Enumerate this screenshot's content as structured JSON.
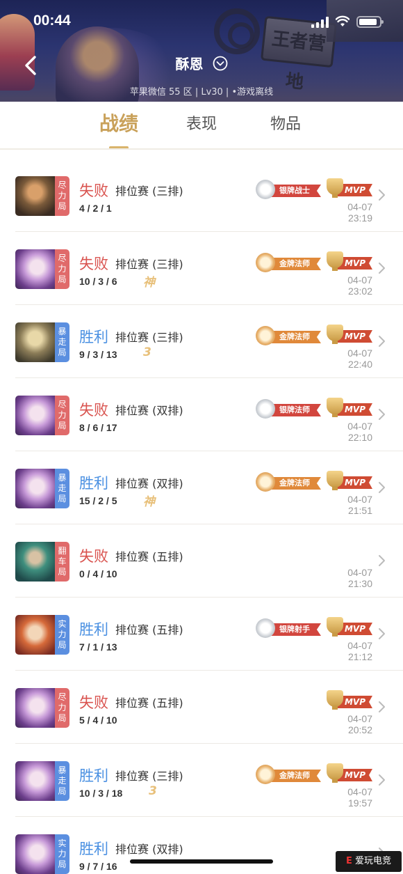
{
  "status_bar": {
    "time": "00:44"
  },
  "header": {
    "nickname": "酥恩",
    "sub_info": "苹果微信 55 区 | Lv30 | •游戏离线",
    "sign_text": "王者营地"
  },
  "tabs": [
    {
      "label": "战绩",
      "active": true
    },
    {
      "label": "表现",
      "active": false
    },
    {
      "label": "物品",
      "active": false
    }
  ],
  "colors": {
    "accent_gold": "#c9a15a",
    "lose_red": "#d9534f",
    "win_blue": "#4a90e2",
    "tag_red": "#e06a6a",
    "tag_blue": "#5b8fe0",
    "mvp_red": "#cf4b33",
    "gold_badge": "#e0893a",
    "silver_badge": "#d2463e"
  },
  "matches": [
    {
      "tag": "尽力局",
      "tag_color": "red",
      "result": "失败",
      "outcome": "lose",
      "mode": "排位赛 (三排)",
      "kda": "4 / 2 / 1",
      "special": "",
      "badge": "银牌战士",
      "badge_tier": "silver",
      "mvp": "MVP",
      "time": "04-07 23:19",
      "hero": "warrior"
    },
    {
      "tag": "尽力局",
      "tag_color": "red",
      "result": "失败",
      "outcome": "lose",
      "mode": "排位赛 (三排)",
      "kda": "10 / 3 / 6",
      "special": "神",
      "badge": "金牌法师",
      "badge_tier": "gold",
      "mvp": "MVP",
      "time": "04-07 23:02",
      "hero": "mage"
    },
    {
      "tag": "暴走局",
      "tag_color": "blue",
      "result": "胜利",
      "outcome": "win",
      "mode": "排位赛 (三排)",
      "kda": "9 / 3 / 13",
      "special": "3",
      "badge": "金牌法师",
      "badge_tier": "gold",
      "mvp": "MVP",
      "time": "04-07 22:40",
      "hero": "sage"
    },
    {
      "tag": "尽力局",
      "tag_color": "red",
      "result": "失败",
      "outcome": "lose",
      "mode": "排位赛 (双排)",
      "kda": "8 / 6 / 17",
      "special": "",
      "badge": "银牌法师",
      "badge_tier": "silver",
      "mvp": "MVP",
      "time": "04-07 22:10",
      "hero": "mage"
    },
    {
      "tag": "暴走局",
      "tag_color": "blue",
      "result": "胜利",
      "outcome": "win",
      "mode": "排位赛 (双排)",
      "kda": "15 / 2 / 5",
      "special": "神",
      "badge": "金牌法师",
      "badge_tier": "gold",
      "mvp": "MVP",
      "time": "04-07 21:51",
      "hero": "mage"
    },
    {
      "tag": "翻车局",
      "tag_color": "red",
      "result": "失败",
      "outcome": "lose",
      "mode": "排位赛 (五排)",
      "kda": "0 / 4 / 10",
      "special": "",
      "badge": "",
      "badge_tier": "",
      "mvp": "",
      "time": "04-07 21:30",
      "hero": "green"
    },
    {
      "tag": "实力局",
      "tag_color": "blue",
      "result": "胜利",
      "outcome": "win",
      "mode": "排位赛 (五排)",
      "kda": "7 / 1 / 13",
      "special": "",
      "badge": "银牌射手",
      "badge_tier": "silver",
      "mvp": "MVP",
      "time": "04-07 21:12",
      "hero": "girl"
    },
    {
      "tag": "尽力局",
      "tag_color": "red",
      "result": "失败",
      "outcome": "lose",
      "mode": "排位赛 (五排)",
      "kda": "5 / 4 / 10",
      "special": "",
      "badge": "",
      "badge_tier": "",
      "mvp": "MVP",
      "time": "04-07 20:52",
      "hero": "mage"
    },
    {
      "tag": "暴走局",
      "tag_color": "blue",
      "result": "胜利",
      "outcome": "win",
      "mode": "排位赛 (三排)",
      "kda": "10 / 3 / 18",
      "special": "3",
      "badge": "金牌法师",
      "badge_tier": "gold",
      "mvp": "MVP",
      "time": "04-07 19:57",
      "hero": "mage"
    },
    {
      "tag": "实力局",
      "tag_color": "blue",
      "result": "胜利",
      "outcome": "win",
      "mode": "排位赛 (双排)",
      "kda": "9 / 7 / 16",
      "special": "",
      "badge": "",
      "badge_tier": "",
      "mvp": "",
      "time": "04-",
      "hero": "mage"
    }
  ],
  "watermark": "爱玩电竞"
}
